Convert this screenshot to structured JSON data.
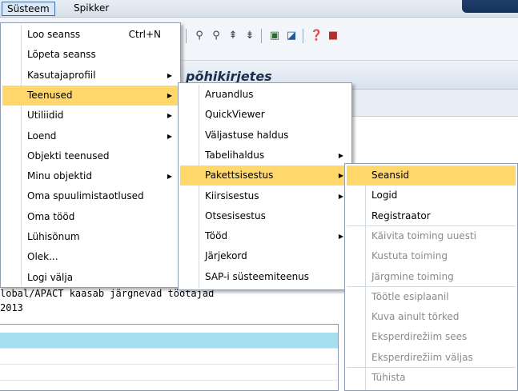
{
  "menubar": {
    "items": [
      "Süsteem",
      "Spikker"
    ]
  },
  "title": {
    "text": "põhikirjetes"
  },
  "content": {
    "line1": "lobal/APACT kaasab järgnevad töötajad",
    "line2": "2013"
  },
  "menus": {
    "system": {
      "items": [
        {
          "label": "Loo seanss",
          "accel": "Ctrl+N",
          "submenu": false,
          "highlighted": false
        },
        {
          "label": "Lõpeta seanss",
          "submenu": false,
          "highlighted": false
        },
        {
          "label": "Kasutajaprofiil",
          "submenu": true,
          "highlighted": false
        },
        {
          "label": "Teenused",
          "submenu": true,
          "highlighted": true
        },
        {
          "label": "Utiliidid",
          "submenu": true,
          "highlighted": false
        },
        {
          "label": "Loend",
          "submenu": true,
          "highlighted": false
        },
        {
          "label": "Objekti teenused",
          "submenu": false,
          "highlighted": false
        },
        {
          "label": "Minu objektid",
          "submenu": true,
          "highlighted": false
        },
        {
          "label": "Oma spuulimistaotlused",
          "submenu": false,
          "highlighted": false
        },
        {
          "label": "Oma tööd",
          "submenu": false,
          "highlighted": false
        },
        {
          "label": "Lühisõnum",
          "submenu": false,
          "highlighted": false
        },
        {
          "label": "Olek...",
          "submenu": false,
          "highlighted": false
        },
        {
          "label": "Logi välja",
          "submenu": false,
          "highlighted": false
        }
      ]
    },
    "services": {
      "items": [
        {
          "label": "Aruandlus",
          "submenu": false,
          "highlighted": false
        },
        {
          "label": "QuickViewer",
          "submenu": false,
          "highlighted": false
        },
        {
          "label": "Väljastuse haldus",
          "submenu": false,
          "highlighted": false
        },
        {
          "label": "Tabelihaldus",
          "submenu": true,
          "highlighted": false
        },
        {
          "label": "Pakettsisestus",
          "submenu": true,
          "highlighted": true
        },
        {
          "label": "Kiirsisestus",
          "submenu": true,
          "highlighted": false
        },
        {
          "label": "Otsesisestus",
          "submenu": false,
          "highlighted": false
        },
        {
          "label": "Tööd",
          "submenu": true,
          "highlighted": false
        },
        {
          "label": "Järjekord",
          "submenu": false,
          "highlighted": false
        },
        {
          "label": "SAP-i süsteemiteenus",
          "submenu": false,
          "highlighted": false
        }
      ]
    },
    "batch": {
      "items": [
        {
          "label": "Seansid",
          "disabled": false,
          "highlighted": true
        },
        {
          "label": "Logid",
          "disabled": false,
          "highlighted": false
        },
        {
          "label": "Registraator",
          "disabled": false,
          "highlighted": false
        },
        {
          "label": "Käivita toiming uuesti",
          "disabled": true,
          "highlighted": false
        },
        {
          "label": "Kustuta toiming",
          "disabled": true,
          "highlighted": false
        },
        {
          "label": "Järgmine toiming",
          "disabled": true,
          "highlighted": false
        },
        {
          "label": "Töötle esiplaanil",
          "disabled": true,
          "highlighted": false
        },
        {
          "label": "Kuva ainult tõrked",
          "disabled": true,
          "highlighted": false
        },
        {
          "label": "Eksperdirežiim sees",
          "disabled": true,
          "highlighted": false
        },
        {
          "label": "Eksperdirežiim väljas",
          "disabled": true,
          "highlighted": false
        },
        {
          "label": "Tühista",
          "disabled": true,
          "highlighted": false
        }
      ]
    }
  },
  "colors": {
    "highlight": "#ffd76a",
    "selected_row": "#a8dff0",
    "disabled_text": "#8a8a8a"
  }
}
